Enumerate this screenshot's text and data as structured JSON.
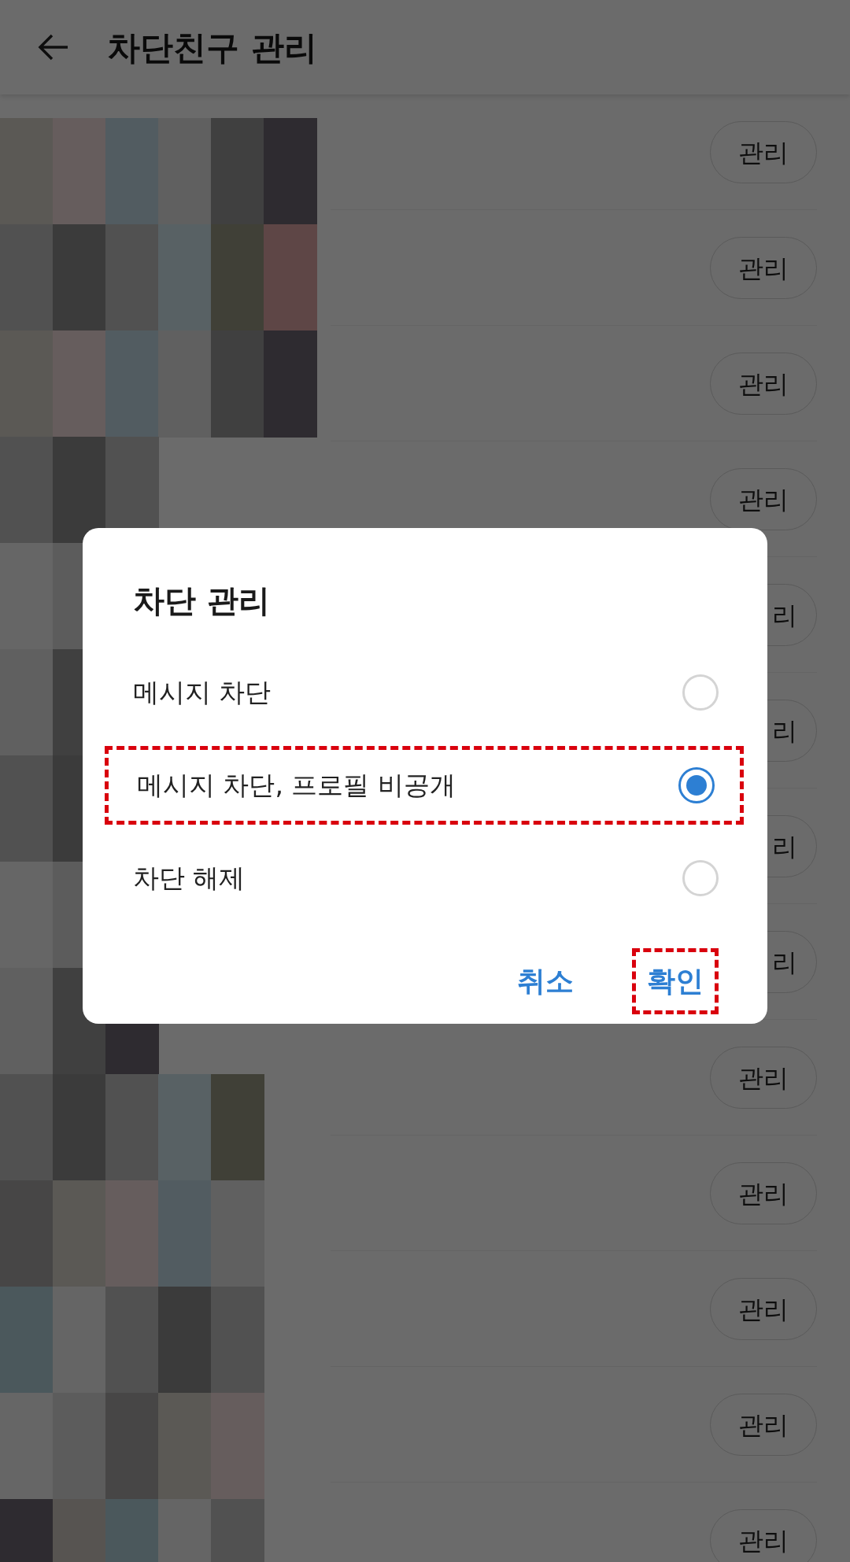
{
  "header": {
    "title": "차단친구 관리"
  },
  "rows": [
    {
      "button": "관리"
    },
    {
      "button": "관리"
    },
    {
      "button": "관리"
    },
    {
      "button": "관리"
    },
    {
      "button": "리",
      "covered": true
    },
    {
      "button": "리",
      "covered": true
    },
    {
      "button": "리",
      "covered": true
    },
    {
      "button": "리",
      "covered": true
    },
    {
      "button": "관리"
    },
    {
      "button": "관리"
    },
    {
      "button": "관리"
    },
    {
      "button": "관리"
    },
    {
      "button": "관리"
    }
  ],
  "dialog": {
    "title": "차단 관리",
    "options": [
      {
        "label": "메시지 차단",
        "selected": false,
        "highlighted": false
      },
      {
        "label": "메시지 차단, 프로필 비공개",
        "selected": true,
        "highlighted": true
      },
      {
        "label": "차단 해제",
        "selected": false,
        "highlighted": false
      }
    ],
    "buttons": [
      {
        "label": "취소",
        "highlighted": false
      },
      {
        "label": "확인",
        "highlighted": true
      }
    ]
  }
}
